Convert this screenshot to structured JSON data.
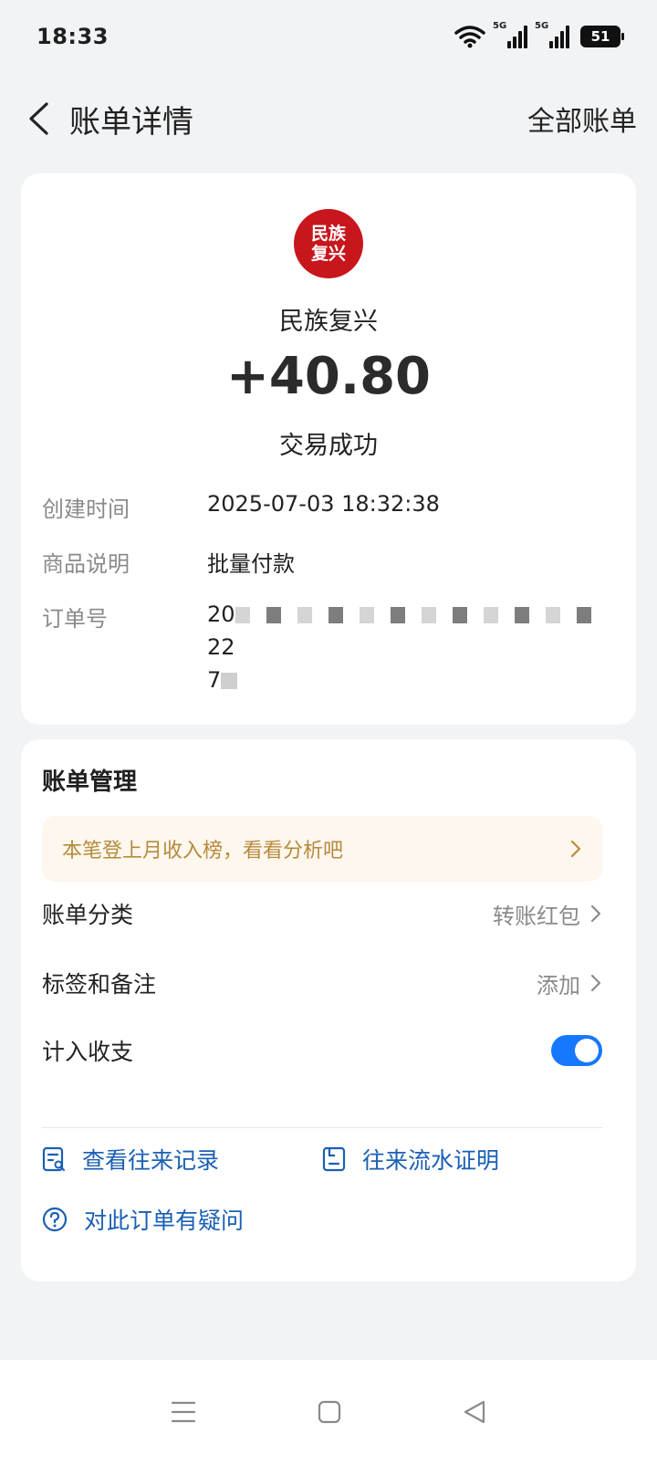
{
  "status_bar": {
    "time": "18:33",
    "signal1_tag": "5G",
    "signal2_tag": "5G",
    "battery": "51"
  },
  "nav": {
    "title": "账单详情",
    "right_link": "全部账单"
  },
  "bill": {
    "logo_line1": "民族",
    "logo_line2": "复兴",
    "merchant": "民族复兴",
    "amount": "+40.80",
    "status": "交易成功",
    "rows": [
      {
        "label": "创建时间",
        "value": "2025-07-03 18:32:38"
      },
      {
        "label": "商品说明",
        "value": "批量付款"
      },
      {
        "label": "订单号",
        "value_start": "20",
        "value_end": "22",
        "value_line2": "7"
      }
    ]
  },
  "management": {
    "title": "账单管理",
    "promo": "本笔登上月收入榜，看看分析吧",
    "category": {
      "label": "账单分类",
      "value": "转账红包"
    },
    "tags": {
      "label": "标签和备注",
      "value": "添加"
    },
    "count": {
      "label": "计入收支",
      "enabled": true
    },
    "links": {
      "records": "查看往来记录",
      "proof": "往来流水证明",
      "question": "对此订单有疑问"
    }
  },
  "colors": {
    "accent": "#1677ff",
    "link": "#1a5fb4",
    "promo_text": "#b78a3c",
    "logo_red": "#c8161d"
  }
}
